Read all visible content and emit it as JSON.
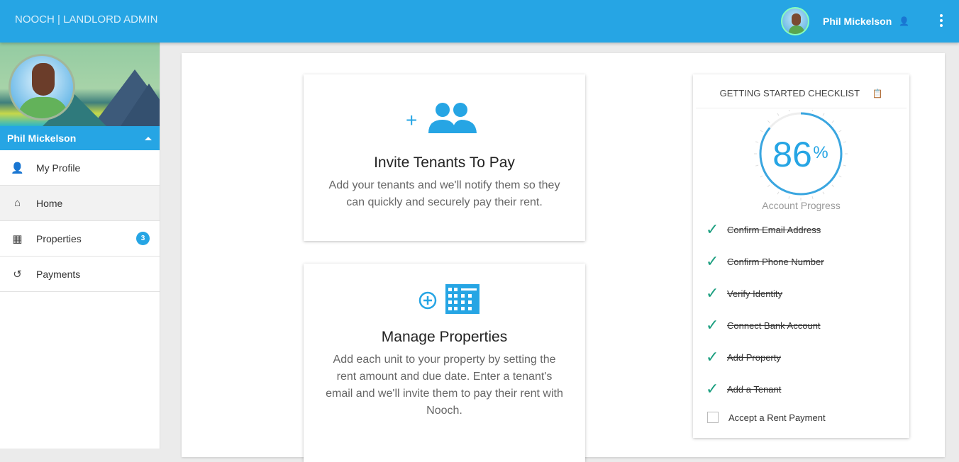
{
  "header": {
    "brand": "NOOCH | LANDLORD ADMIN",
    "user_name": "Phil Mickelson"
  },
  "sidebar": {
    "user_name": "Phil Mickelson",
    "items": [
      {
        "label": "My Profile",
        "icon": "person-icon",
        "active": false
      },
      {
        "label": "Home",
        "icon": "home-icon",
        "active": true
      },
      {
        "label": "Properties",
        "icon": "building-icon",
        "badge": "3",
        "active": false
      },
      {
        "label": "Payments",
        "icon": "history-icon",
        "active": false
      }
    ]
  },
  "cards": [
    {
      "title": "Invite Tenants To Pay",
      "text": "Add your tenants and we'll notify them so they can quickly and securely pay their rent.",
      "icon": "add-group-icon"
    },
    {
      "title": "Manage Properties",
      "text": "Add each unit to your property by setting the rent amount and due date. Enter a tenant's email and we'll invite them to pay their rent with Nooch.",
      "icon": "add-building-icon"
    }
  ],
  "checklist": {
    "title": "GETTING STARTED CHECKLIST",
    "progress": 86,
    "progress_unit": "%",
    "progress_label": "Account Progress",
    "accent": "#26a5e4",
    "items": [
      {
        "label": "Confirm Email Address",
        "done": true
      },
      {
        "label": "Confirm Phone Number",
        "done": true
      },
      {
        "label": "Verify Identity",
        "done": true
      },
      {
        "label": "Connect Bank Account",
        "done": true
      },
      {
        "label": "Add Property",
        "done": true
      },
      {
        "label": "Add a Tenant",
        "done": true
      },
      {
        "label": "Accept a Rent Payment",
        "done": false
      }
    ]
  }
}
